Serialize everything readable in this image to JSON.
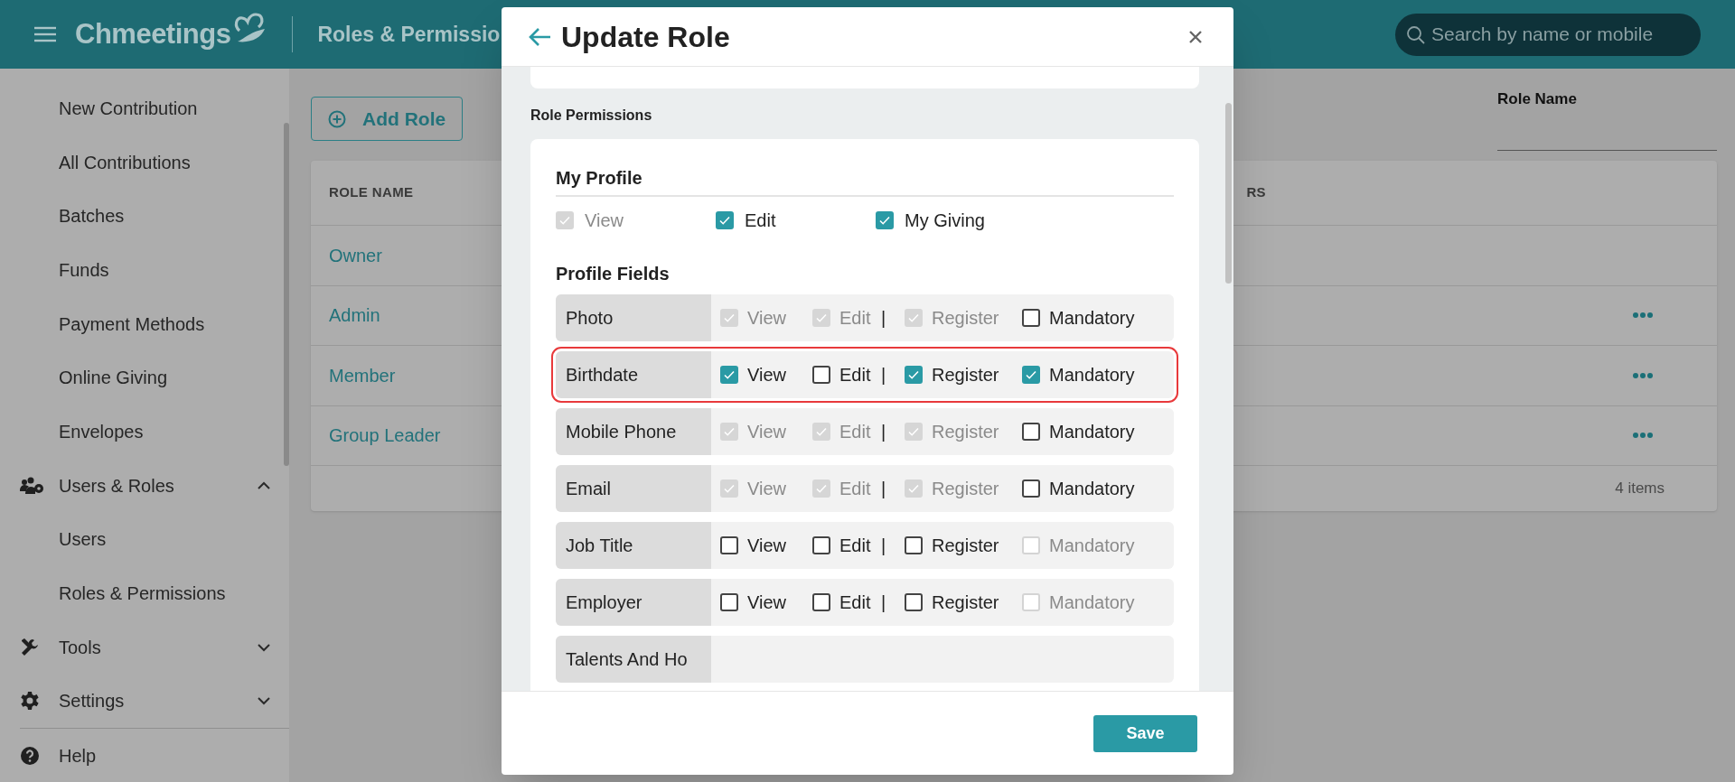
{
  "header": {
    "brand": "Chmeetings",
    "page_title": "Roles & Permissio",
    "search": {
      "placeholder": "Search by name or mobile"
    }
  },
  "sidebar": {
    "items": [
      {
        "kind": "link",
        "label": "New Contribution"
      },
      {
        "kind": "link",
        "label": "All Contributions"
      },
      {
        "kind": "link",
        "label": "Batches"
      },
      {
        "kind": "link",
        "label": "Funds"
      },
      {
        "kind": "link",
        "label": "Payment Methods"
      },
      {
        "kind": "link",
        "label": "Online Giving"
      },
      {
        "kind": "link",
        "label": "Envelopes"
      },
      {
        "kind": "users",
        "label": "Users & Roles",
        "expanded": true
      },
      {
        "kind": "link",
        "label": "Users"
      },
      {
        "kind": "link",
        "label": "Roles & Permissions"
      },
      {
        "kind": "tools",
        "label": "Tools",
        "expanded": false
      },
      {
        "kind": "settings",
        "label": "Settings",
        "expanded": false
      },
      {
        "kind": "help",
        "label": "Help"
      }
    ]
  },
  "toolbar": {
    "add_button": "Add Role",
    "filter": {
      "label": "Role Name"
    }
  },
  "table": {
    "columns": [
      "ROLE NAME",
      "RS"
    ],
    "rows": [
      {
        "name": "Owner",
        "actions": false
      },
      {
        "name": "Admin",
        "actions": true
      },
      {
        "name": "Member",
        "actions": true
      },
      {
        "name": "Group Leader",
        "actions": true
      }
    ],
    "footer": "4 items"
  },
  "modal": {
    "title": "Update Role",
    "section_label": "Role Permissions",
    "my_profile": {
      "title": "My Profile",
      "options": [
        {
          "label": "View",
          "checked": true,
          "disabled": true
        },
        {
          "label": "Edit",
          "checked": true,
          "disabled": false
        },
        {
          "label": "My Giving",
          "checked": true,
          "disabled": false
        }
      ]
    },
    "profile_fields": {
      "title": "Profile Fields",
      "rows": [
        {
          "name": "Photo",
          "highlighted": false,
          "separator": "|",
          "permissions": [
            {
              "label": "View",
              "checked": true,
              "disabled": true
            },
            {
              "label": "Edit",
              "checked": true,
              "disabled": true
            },
            {
              "label": "Register",
              "checked": true,
              "disabled": true
            },
            {
              "label": "Mandatory",
              "checked": false,
              "disabled": false
            }
          ]
        },
        {
          "name": "Birthdate",
          "highlighted": true,
          "separator": "|",
          "permissions": [
            {
              "label": "View",
              "checked": true,
              "disabled": false
            },
            {
              "label": "Edit",
              "checked": false,
              "disabled": false
            },
            {
              "label": "Register",
              "checked": true,
              "disabled": false
            },
            {
              "label": "Mandatory",
              "checked": true,
              "disabled": false
            }
          ]
        },
        {
          "name": "Mobile Phone",
          "highlighted": false,
          "separator": "|",
          "permissions": [
            {
              "label": "View",
              "checked": true,
              "disabled": true
            },
            {
              "label": "Edit",
              "checked": true,
              "disabled": true
            },
            {
              "label": "Register",
              "checked": true,
              "disabled": true
            },
            {
              "label": "Mandatory",
              "checked": false,
              "disabled": false
            }
          ]
        },
        {
          "name": "Email",
          "highlighted": false,
          "separator": "|",
          "permissions": [
            {
              "label": "View",
              "checked": true,
              "disabled": true
            },
            {
              "label": "Edit",
              "checked": true,
              "disabled": true
            },
            {
              "label": "Register",
              "checked": true,
              "disabled": true
            },
            {
              "label": "Mandatory",
              "checked": false,
              "disabled": false
            }
          ]
        },
        {
          "name": "Job Title",
          "highlighted": false,
          "separator": "|",
          "permissions": [
            {
              "label": "View",
              "checked": false,
              "disabled": false
            },
            {
              "label": "Edit",
              "checked": false,
              "disabled": false
            },
            {
              "label": "Register",
              "checked": false,
              "disabled": false
            },
            {
              "label": "Mandatory",
              "checked": false,
              "disabled": true
            }
          ]
        },
        {
          "name": "Employer",
          "highlighted": false,
          "separator": "|",
          "permissions": [
            {
              "label": "View",
              "checked": false,
              "disabled": false
            },
            {
              "label": "Edit",
              "checked": false,
              "disabled": false
            },
            {
              "label": "Register",
              "checked": false,
              "disabled": false
            },
            {
              "label": "Mandatory",
              "checked": false,
              "disabled": true
            }
          ]
        },
        {
          "name": "Talents And Ho",
          "highlighted": false
        }
      ]
    },
    "save_button": "Save"
  }
}
